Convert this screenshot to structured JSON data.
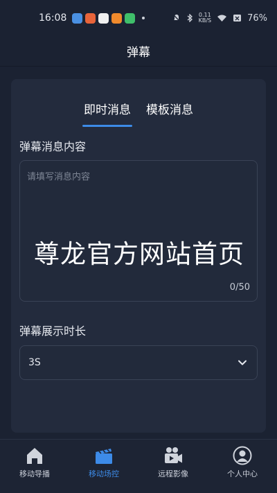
{
  "status_bar": {
    "time": "16:08",
    "net_speed_value": "0.11",
    "net_speed_unit": "KB/S",
    "battery": "76%"
  },
  "header": {
    "title": "弹幕"
  },
  "tabs": [
    {
      "label": "即时消息",
      "active": true
    },
    {
      "label": "模板消息",
      "active": false
    }
  ],
  "form": {
    "message_label": "弹幕消息内容",
    "message_placeholder": "请填写消息内容",
    "message_value": "尊龙官方网站首页",
    "counter": "0/50",
    "duration_label": "弹幕展示时长",
    "duration_value": "3S"
  },
  "bottom_nav": [
    {
      "label": "移动导播",
      "icon": "home-icon",
      "active": false
    },
    {
      "label": "移动场控",
      "icon": "clapperboard-icon",
      "active": true
    },
    {
      "label": "远程影像",
      "icon": "video-camera-icon",
      "active": false
    },
    {
      "label": "个人中心",
      "icon": "user-icon",
      "active": false
    }
  ],
  "colors": {
    "accent": "#3d8be8",
    "background": "#1b2232",
    "card": "#232b3d"
  }
}
